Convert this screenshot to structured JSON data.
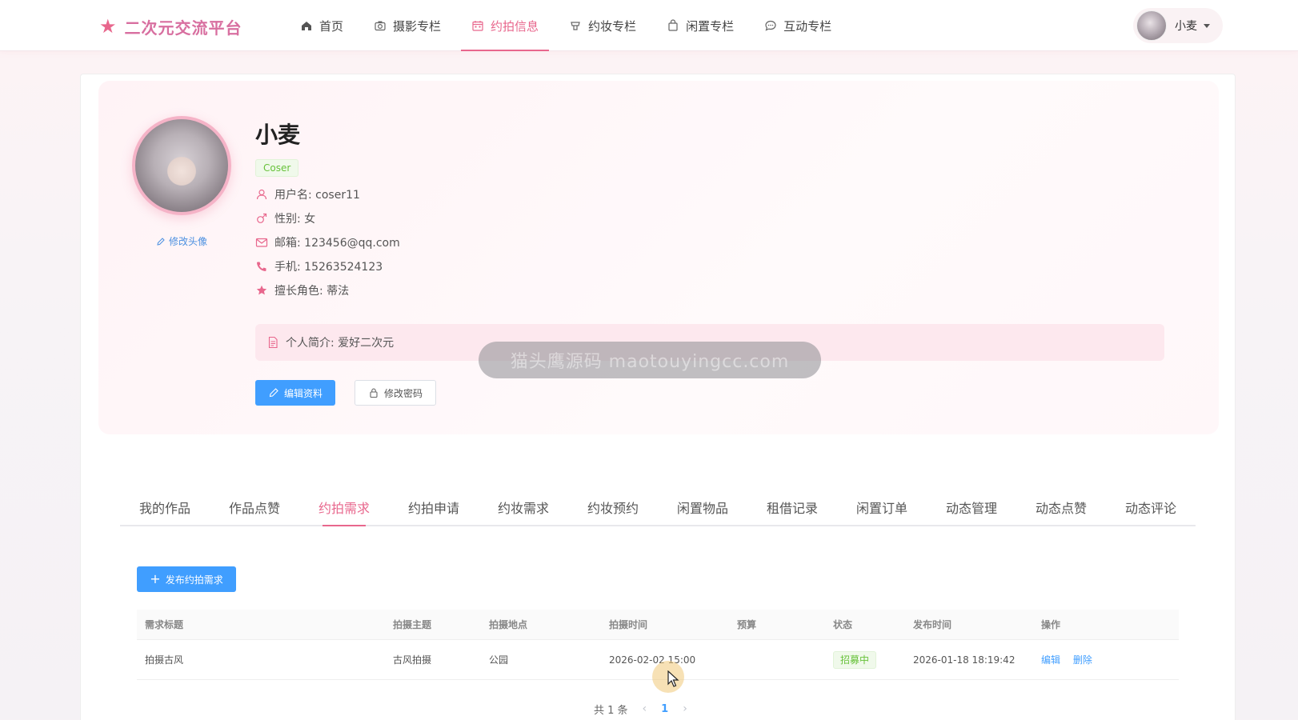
{
  "brand": {
    "title": "二次元交流平台"
  },
  "nav": {
    "items": [
      {
        "label": "首页",
        "icon": "home-icon"
      },
      {
        "label": "摄影专栏",
        "icon": "camera-icon"
      },
      {
        "label": "约拍信息",
        "icon": "calendar-icon",
        "active": true
      },
      {
        "label": "约妆专栏",
        "icon": "makeup-icon"
      },
      {
        "label": "闲置专栏",
        "icon": "bag-icon"
      },
      {
        "label": "互动专栏",
        "icon": "chat-icon"
      }
    ]
  },
  "user": {
    "name": "小麦"
  },
  "profile": {
    "name": "小麦",
    "role": "Coser",
    "change_avatar": "修改头像",
    "username": "用户名: coser11",
    "gender": "性别: 女",
    "email": "邮箱: 123456@qq.com",
    "phone": "手机: 15263524123",
    "skill": "擅长角色: 蒂法",
    "bio": "个人简介: 爱好二次元",
    "edit_button": "编辑资料",
    "password_button": "修改密码"
  },
  "watermark": "猫头鹰源码 maotouyingcc.com",
  "tabs": [
    {
      "label": "我的作品"
    },
    {
      "label": "作品点赞"
    },
    {
      "label": "约拍需求",
      "active": true
    },
    {
      "label": "约拍申请"
    },
    {
      "label": "约妆需求"
    },
    {
      "label": "约妆预约"
    },
    {
      "label": "闲置物品"
    },
    {
      "label": "租借记录"
    },
    {
      "label": "闲置订单"
    },
    {
      "label": "动态管理"
    },
    {
      "label": "动态点赞"
    },
    {
      "label": "动态评论"
    }
  ],
  "add_button": "发布约拍需求",
  "table": {
    "headers": [
      "需求标题",
      "拍摄主题",
      "拍摄地点",
      "拍摄时间",
      "预算",
      "状态",
      "发布时间",
      "操作"
    ],
    "rows": [
      {
        "title": "拍摄古风",
        "theme": "古风拍摄",
        "location": "公园",
        "time": "2026-02-02 15:00",
        "budget": "",
        "status": "招募中",
        "published": "2026-01-18 18:19:42",
        "edit": "编辑",
        "delete": "删除"
      }
    ]
  },
  "pagination": {
    "total": "共 1 条",
    "page": "1"
  },
  "colors": {
    "accent": "#e8678d",
    "primary": "#409eff",
    "success": "#67c23a"
  }
}
